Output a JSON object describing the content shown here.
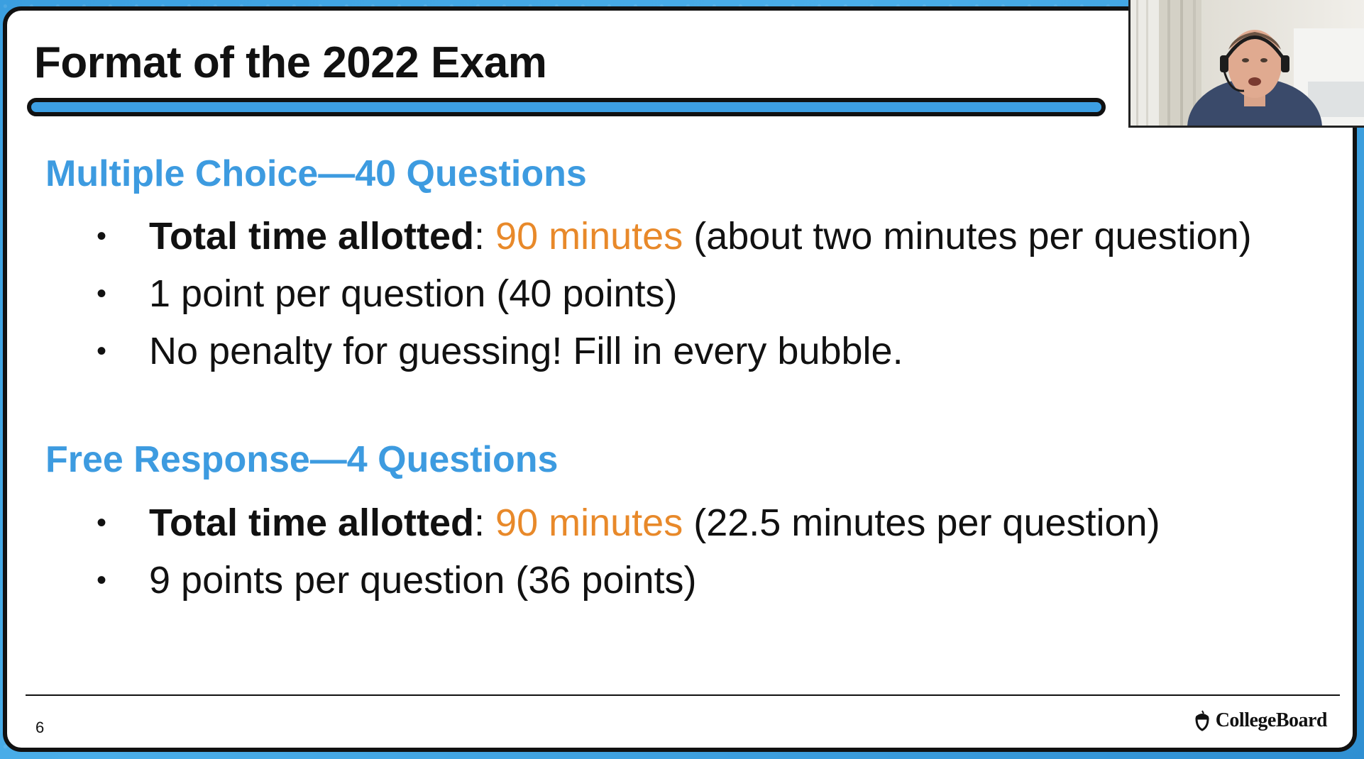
{
  "slide": {
    "title": "Format of the 2022 Exam",
    "page_number": "6",
    "logo_text": "CollegeBoard"
  },
  "sections": [
    {
      "heading": "Multiple Choice—40 Questions",
      "bullets": [
        {
          "bold": "Total time allotted",
          "sep": ": ",
          "highlight": "90 minutes",
          "rest": " (about two minutes per question)"
        },
        {
          "bold": "",
          "sep": "",
          "highlight": "",
          "rest": "1 point per question (40 points)"
        },
        {
          "bold": "",
          "sep": "",
          "highlight": "",
          "rest": "No penalty for guessing!  Fill in every bubble."
        }
      ]
    },
    {
      "heading": "Free Response—4 Questions",
      "bullets": [
        {
          "bold": "Total time allotted",
          "sep": ": ",
          "highlight": "90 minutes",
          "rest": "  (22.5 minutes per question)"
        },
        {
          "bold": "",
          "sep": "",
          "highlight": "",
          "rest": "9 points per question (36 points)"
        }
      ]
    }
  ],
  "bullet_glyph": "•",
  "colors": {
    "heading_blue": "#3d9be0",
    "highlight_orange": "#e8892a",
    "title_bar_blue": "#3d9fe3"
  }
}
